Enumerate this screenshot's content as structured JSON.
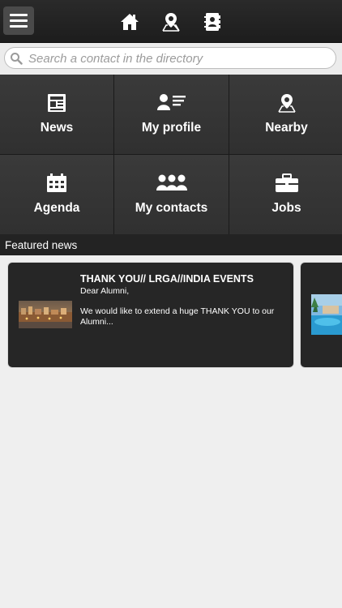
{
  "header": {
    "menu_icon": "hamburger-icon",
    "icons": [
      "home-icon",
      "map-pin-icon",
      "address-book-icon"
    ]
  },
  "search": {
    "placeholder": "Search a contact in the directory"
  },
  "tiles": [
    {
      "label": "News",
      "icon": "newspaper-icon"
    },
    {
      "label": "My profile",
      "icon": "profile-card-icon"
    },
    {
      "label": "Nearby",
      "icon": "map-pin-icon"
    },
    {
      "label": "Agenda",
      "icon": "calendar-icon"
    },
    {
      "label": "My contacts",
      "icon": "group-icon"
    },
    {
      "label": "Jobs",
      "icon": "briefcase-icon"
    }
  ],
  "featured": {
    "heading": "Featured news",
    "cards": [
      {
        "title": "THANK YOU// LRGA//INDIA EVENTS",
        "subtitle": "Dear Alumni,",
        "body": "We would like to extend a huge THANK YOU to our Alumni..."
      }
    ]
  },
  "colors": {
    "topbar": "#1d1d1d",
    "tile": "#343434",
    "card": "#262626",
    "background": "#efefef"
  }
}
